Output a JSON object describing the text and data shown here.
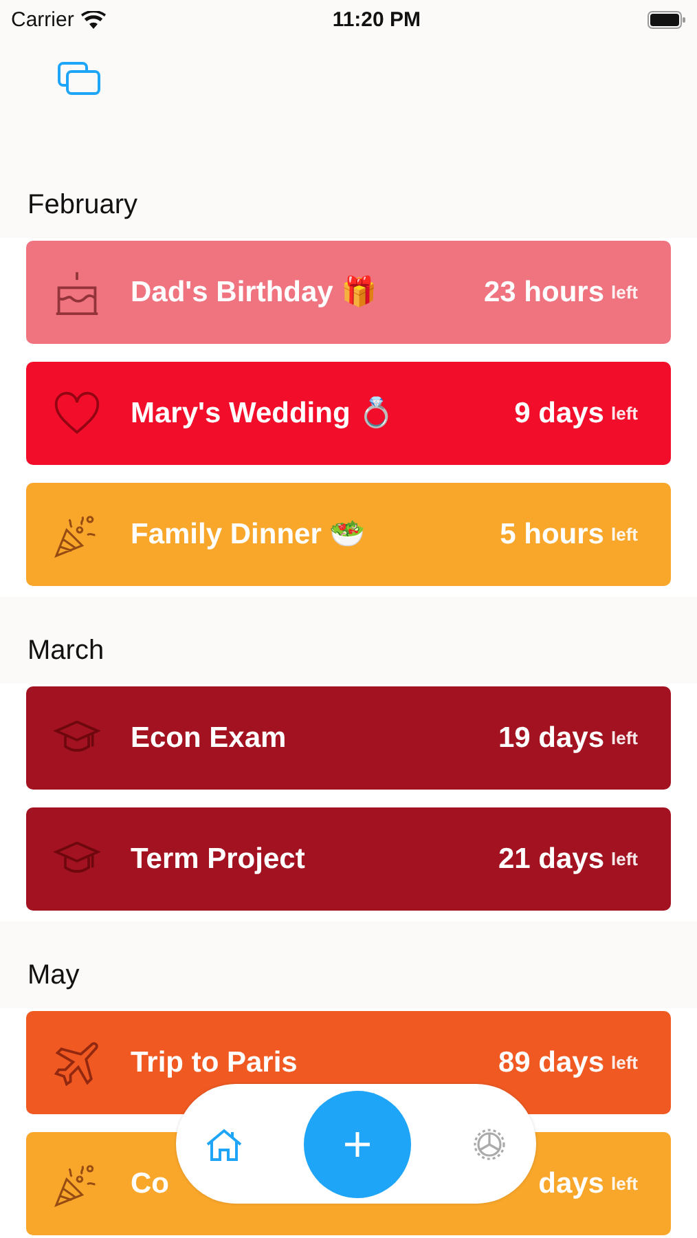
{
  "status_bar": {
    "carrier": "Carrier",
    "time": "11:20 PM"
  },
  "sections": [
    {
      "title": "February",
      "events": [
        {
          "kind": "cake",
          "color": "#f07380",
          "title": "Dad's Birthday 🎁",
          "count": "23 hours",
          "suffix": "left"
        },
        {
          "kind": "heart",
          "color": "#f20d2b",
          "title": "Mary's Wedding 💍",
          "count": "9 days",
          "suffix": "left"
        },
        {
          "kind": "party",
          "color": "#f9a72b",
          "title": "Family Dinner 🥗",
          "count": "5 hours",
          "suffix": "left"
        }
      ]
    },
    {
      "title": "March",
      "events": [
        {
          "kind": "cap",
          "color": "#a31220",
          "title": "Econ Exam",
          "count": "19 days",
          "suffix": "left"
        },
        {
          "kind": "cap",
          "color": "#a31220",
          "title": "Term Project",
          "count": "21 days",
          "suffix": "left"
        }
      ]
    },
    {
      "title": "May",
      "events": [
        {
          "kind": "plane",
          "color": "#f05a22",
          "title": "Trip to Paris",
          "count": "89 days",
          "suffix": "left"
        },
        {
          "kind": "party",
          "color": "#f9a72b",
          "title": "Co",
          "count": "days",
          "suffix": "left"
        }
      ]
    }
  ],
  "tab_bar": {
    "tabs": [
      {
        "kind": "home",
        "selected": true
      },
      {
        "kind": "add",
        "selected": false
      },
      {
        "kind": "settings",
        "selected": false
      }
    ]
  }
}
